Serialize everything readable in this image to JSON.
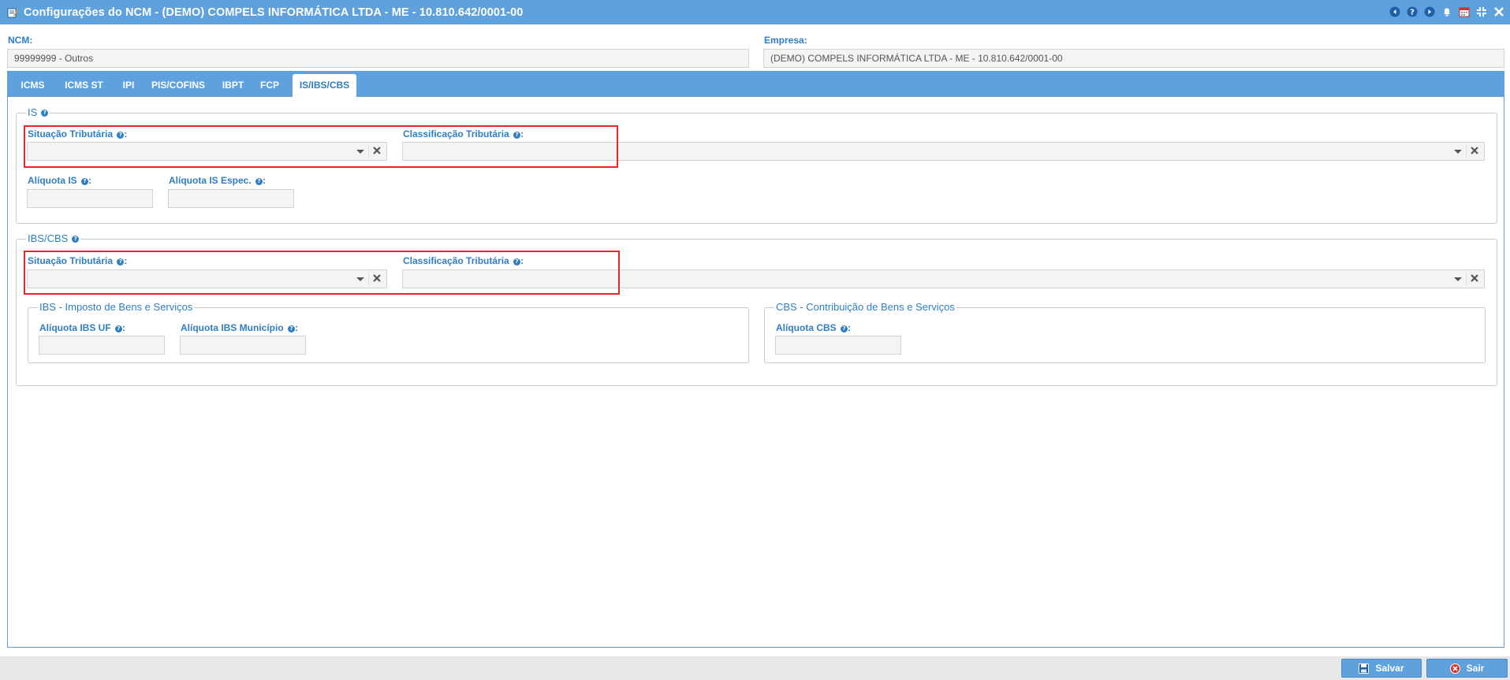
{
  "window": {
    "title": "Configurações do NCM - (DEMO) COMPELS INFORMÁTICA LTDA - ME - 10.810.642/0001-00",
    "controls": [
      "back-icon",
      "help-icon",
      "forward-icon",
      "bell-icon",
      "calendar-icon",
      "compress-icon",
      "close-icon"
    ]
  },
  "header": {
    "ncm_label": "NCM:",
    "ncm_value": "99999999 - Outros",
    "empresa_label": "Empresa:",
    "empresa_value": "(DEMO) COMPELS INFORMÁTICA LTDA - ME - 10.810.642/0001-00"
  },
  "tabs": [
    {
      "label": "ICMS"
    },
    {
      "label": "ICMS ST"
    },
    {
      "label": "IPI"
    },
    {
      "label": "PIS/COFINS"
    },
    {
      "label": "IBPT"
    },
    {
      "label": "FCP"
    },
    {
      "label": "IS/IBS/CBS",
      "active": true
    }
  ],
  "is_section": {
    "legend": "IS",
    "situacao_label": "Situação Tributária",
    "classificacao_label": "Classificação Tributária",
    "aliquota_is_label": "Alíquota IS",
    "aliquota_is_espec_label": "Alíquota IS Espec."
  },
  "ibscbs_section": {
    "legend": "IBS/CBS",
    "situacao_label": "Situação Tributária",
    "classificacao_label": "Classificação Tributária",
    "ibs": {
      "legend": "IBS - Imposto de Bens e Serviços",
      "aliquota_uf_label": "Alíquota IBS UF",
      "aliquota_municipio_label": "Alíquota IBS Município"
    },
    "cbs": {
      "legend": "CBS - Contribuição de Bens e Serviços",
      "aliquota_label": "Alíquota CBS"
    }
  },
  "footer": {
    "save_label": "Salvar",
    "exit_label": "Sair"
  },
  "colors": {
    "accent": "#5fa1dd",
    "label": "#2f7ec5",
    "highlight": "#e8252a"
  }
}
